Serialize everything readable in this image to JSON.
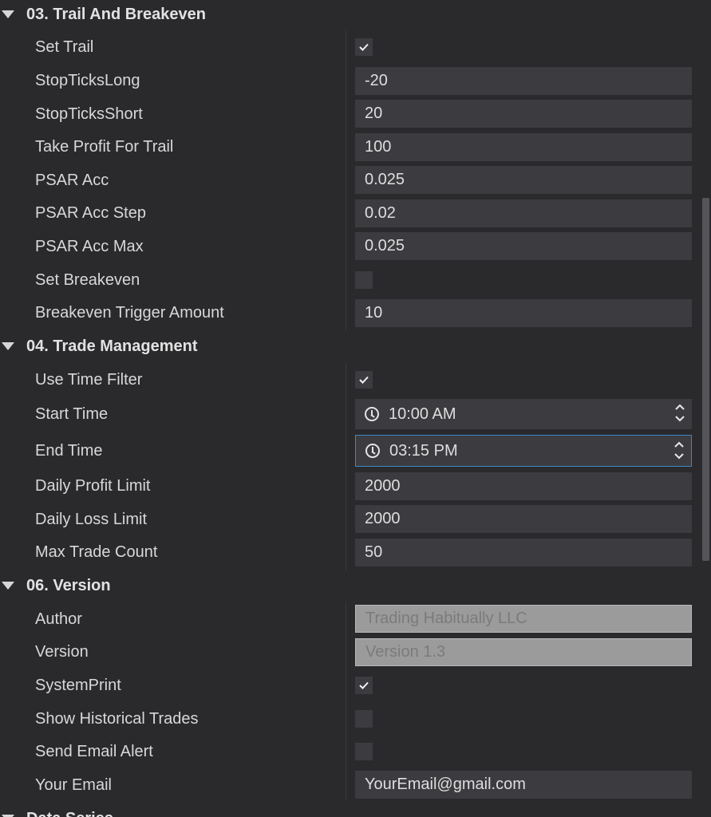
{
  "sections": [
    {
      "title": "03. Trail And Breakeven"
    },
    {
      "title": "04. Trade Management"
    },
    {
      "title": "06. Version"
    },
    {
      "title": "Data Series"
    }
  ],
  "trail": {
    "set_trail": {
      "label": "Set Trail",
      "checked": true
    },
    "stop_ticks_long": {
      "label": "StopTicksLong",
      "value": "-20"
    },
    "stop_ticks_short": {
      "label": "StopTicksShort",
      "value": "20"
    },
    "take_profit_for_trail": {
      "label": "Take Profit For Trail",
      "value": "100"
    },
    "psar_acc": {
      "label": "PSAR Acc",
      "value": "0.025"
    },
    "psar_acc_step": {
      "label": "PSAR Acc Step",
      "value": "0.02"
    },
    "psar_acc_max": {
      "label": "PSAR Acc Max",
      "value": "0.025"
    },
    "set_breakeven": {
      "label": "Set Breakeven",
      "checked": false
    },
    "breakeven_trigger_amount": {
      "label": "Breakeven Trigger Amount",
      "value": "10"
    }
  },
  "trade_mgmt": {
    "use_time_filter": {
      "label": "Use Time Filter",
      "checked": true
    },
    "start_time": {
      "label": "Start Time",
      "value": "10:00 AM"
    },
    "end_time": {
      "label": "End Time",
      "value": "03:15 PM"
    },
    "daily_profit_limit": {
      "label": "Daily Profit Limit",
      "value": "2000"
    },
    "daily_loss_limit": {
      "label": "Daily Loss Limit",
      "value": "2000"
    },
    "max_trade_count": {
      "label": "Max Trade Count",
      "value": "50"
    }
  },
  "version": {
    "author": {
      "label": "Author",
      "value": "Trading Habitually LLC"
    },
    "version": {
      "label": "Version",
      "value": "Version 1.3"
    },
    "system_print": {
      "label": "SystemPrint",
      "checked": true
    },
    "show_historical_trades": {
      "label": "Show Historical Trades",
      "checked": false
    },
    "send_email_alert": {
      "label": "Send Email Alert",
      "checked": false
    },
    "your_email": {
      "label": "Your Email",
      "value": "YourEmail@gmail.com"
    }
  },
  "icons": {
    "section_caret": "triangle-down-icon",
    "check": "checkmark-icon",
    "clock": "clock-icon",
    "spin_up": "chevron-up-icon",
    "spin_down": "chevron-down-icon"
  },
  "colors": {
    "background": "#2a2a2d",
    "input": "#3c3c40",
    "readonly_input": "#9b9b9b",
    "focus_border": "#3d86c6",
    "text": "#dcdcdc"
  }
}
